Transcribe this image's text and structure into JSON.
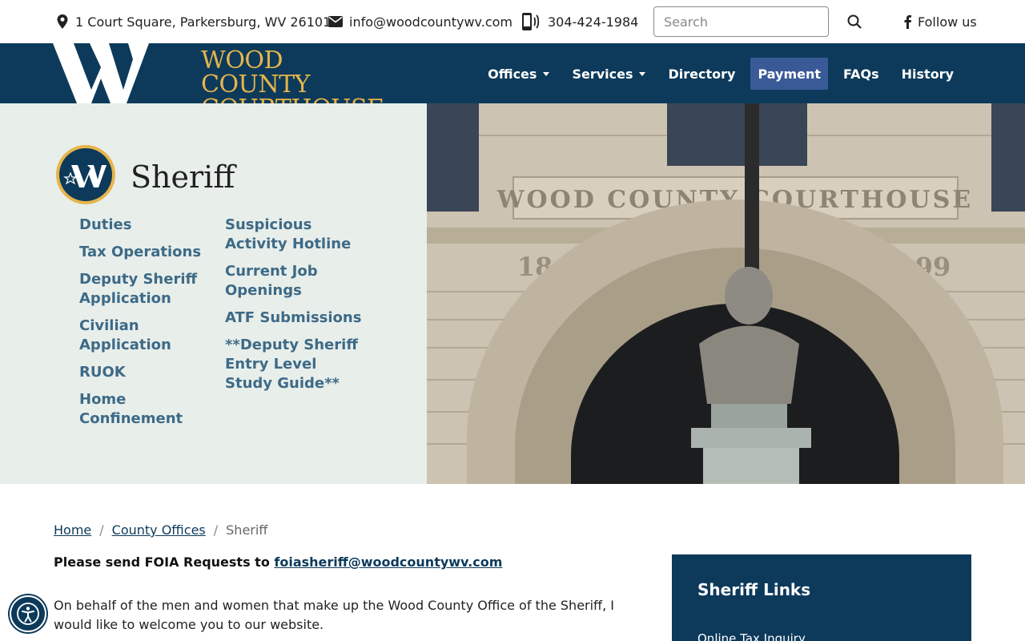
{
  "topbar": {
    "address": "1 Court Square, Parkersburg, WV 26101",
    "email": "info@woodcountywv.com",
    "phone": "304-424-1984",
    "search_placeholder": "Search",
    "follow": "Follow us"
  },
  "header": {
    "logo_line1": "WOOD COUNTY",
    "logo_line2": "COURTHOUSE",
    "nav": [
      {
        "label": "Offices"
      },
      {
        "label": "Services"
      },
      {
        "label": "Directory"
      },
      {
        "label": "Payment"
      },
      {
        "label": "FAQs"
      },
      {
        "label": "History"
      }
    ]
  },
  "hero": {
    "title": "Sheriff",
    "links_col1": [
      "Duties",
      "Tax Operations",
      "Deputy Sheriff Application",
      "Civilian Application",
      "RUOK",
      "Home Confinement"
    ],
    "links_col2": [
      "Suspicious Activity Hotline",
      "Current Job Openings",
      "ATF Submissions",
      "**Deputy Sheriff Entry Level Study Guide**"
    ],
    "building_inscription": "WOOD COUNTY COURTHOUSE",
    "year_left": "18",
    "year_right": "99"
  },
  "breadcrumb": {
    "home": "Home",
    "parent": "County Offices",
    "current": "Sheriff",
    "sep": "/"
  },
  "content": {
    "foia_prefix": "Please send FOIA Requests to ",
    "foia_email": "foiasheriff@woodcountywv.com",
    "welcome": "On behalf of the men and women that make up the Wood County Office of the Sheriff, I would like to welcome you to our website."
  },
  "sidebar": {
    "title": "Sheriff Links",
    "first_link": "Online Tax Inquiry"
  },
  "colors": {
    "navy": "#0d3a5b",
    "gold": "#e6b54a",
    "link": "#3d6a87",
    "active_nav": "#3a5a97",
    "hero_bg": "#e8eeea"
  }
}
